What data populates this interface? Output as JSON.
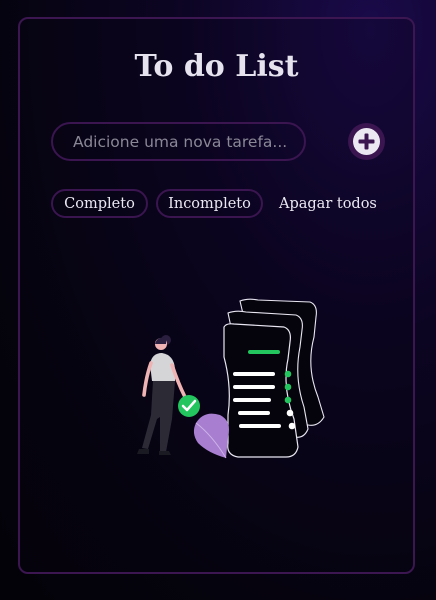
{
  "app": {
    "title": "To do List"
  },
  "input": {
    "placeholder": "Adicione uma nova tarefa...",
    "value": ""
  },
  "add_button": {
    "icon": "plus-circle-icon"
  },
  "filters": [
    {
      "label": "Completo"
    },
    {
      "label": "Incompleto"
    },
    {
      "label": "Apagar todos"
    }
  ],
  "illustration": {
    "name": "empty-tasks-illustration"
  },
  "colors": {
    "accent": "#3a1550",
    "check": "#22c55e",
    "leaf": "#a87ed0"
  }
}
